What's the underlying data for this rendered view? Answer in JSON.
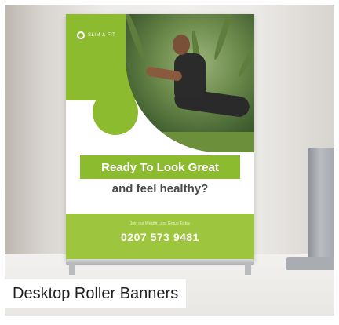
{
  "banner": {
    "logo_text": "SLIM & FIT",
    "headline": "Ready To Look Great",
    "subline": "and feel healthy?",
    "small_text": "Join our Weight Loss Group Today",
    "phone": "0207 573 9481"
  },
  "caption": "Desktop Roller Banners",
  "colors": {
    "accent_green": "#8dbb2f",
    "footer_green": "#9ec53e",
    "text_dark": "#4a4a4a"
  }
}
